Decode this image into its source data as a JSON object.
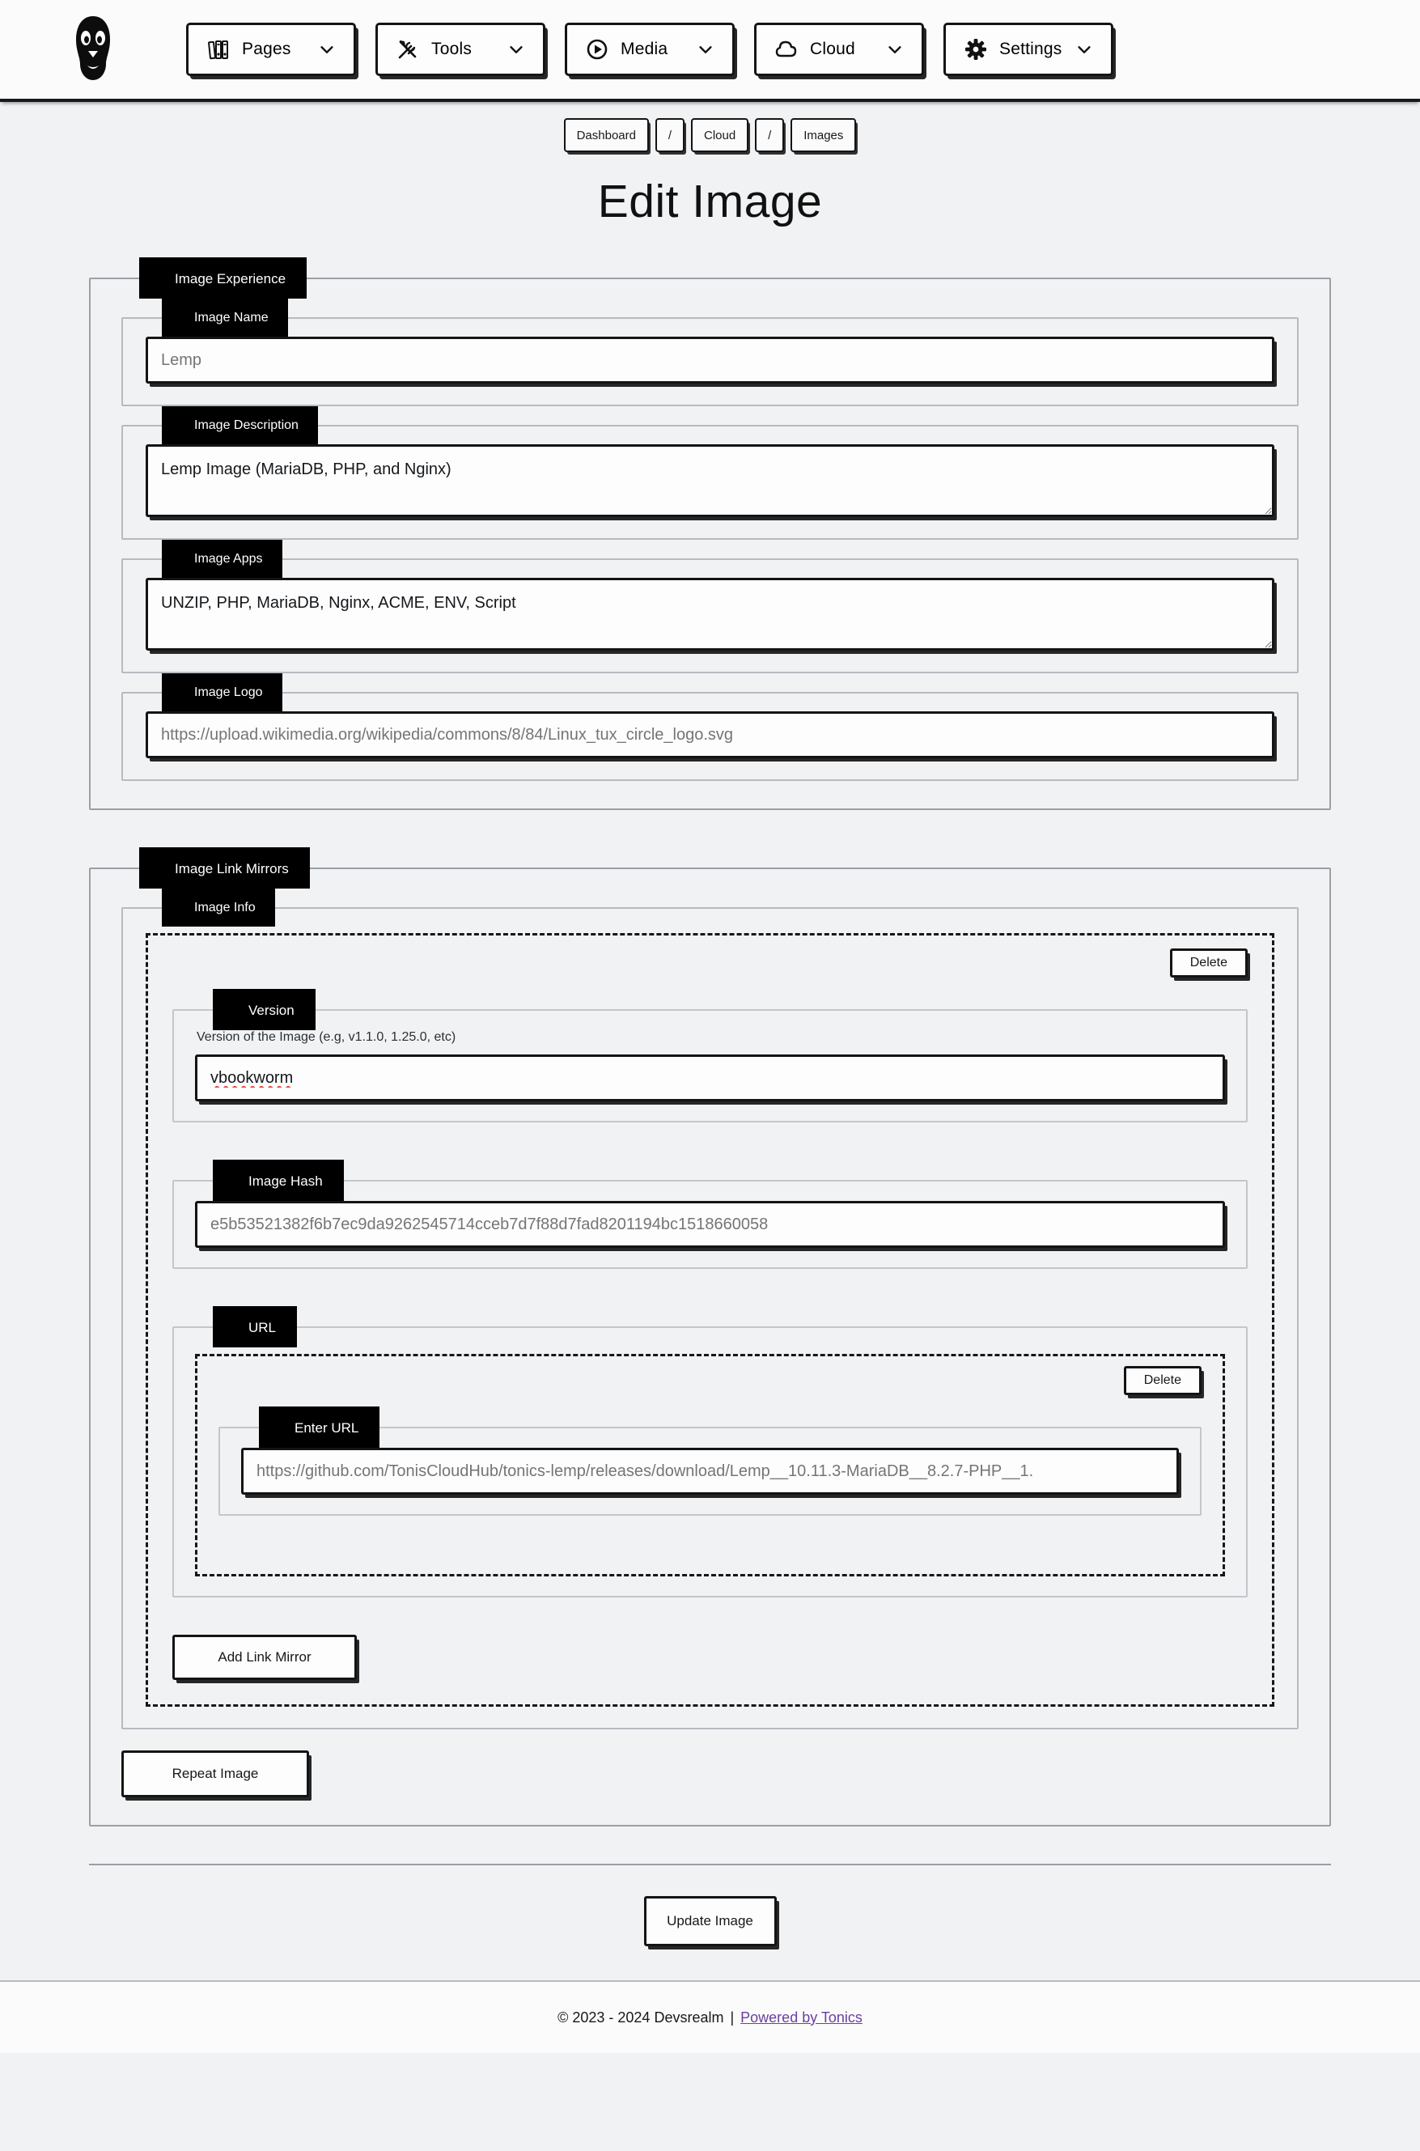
{
  "nav": {
    "logo_name": "devsrealm-tux-logo",
    "items": [
      {
        "label": "Pages",
        "icon": "books-icon"
      },
      {
        "label": "Tools",
        "icon": "tools-icon"
      },
      {
        "label": "Media",
        "icon": "play-circle-icon"
      },
      {
        "label": "Cloud",
        "icon": "cloud-icon"
      },
      {
        "label": "Settings",
        "icon": "gear-icon"
      }
    ]
  },
  "breadcrumb": {
    "items": [
      "Dashboard",
      "/",
      "Cloud",
      "/",
      "Images"
    ]
  },
  "page": {
    "title": "Edit Image"
  },
  "image_experience": {
    "legend": "Image Experience",
    "name": {
      "legend": "Image Name",
      "value": "Lemp",
      "placeholder": "Lemp"
    },
    "description": {
      "legend": "Image Description",
      "value": "Lemp Image (MariaDB, PHP, and Nginx)",
      "placeholder": "Image Description"
    },
    "apps": {
      "legend": "Image Apps",
      "value": "UNZIP, PHP, MariaDB, Nginx, ACME, ENV, Script",
      "placeholder": "Image Apps"
    },
    "logo": {
      "legend": "Image Logo",
      "value": "https://upload.wikimedia.org/wikipedia/commons/8/84/Linux_tux_circle_logo.svg",
      "placeholder": "https://upload.wikimedia.org/wikipedia/commons/8/84/Linux_tux_circle_logo.svg"
    }
  },
  "image_link_mirrors": {
    "legend": "Image Link Mirrors",
    "info": {
      "legend": "Image Info",
      "delete_label": "Delete",
      "version": {
        "legend": "Version",
        "helper": "Version of the Image (e.g, v1.1.0, 1.25.0, etc)",
        "value": "vbookworm",
        "placeholder": "Version"
      },
      "hash": {
        "legend": "Image Hash",
        "value": "e5b53521382f6b7ec9da9262545714cceb7d7f88d7fad8201194bc1518660058",
        "placeholder": "Image Hash"
      },
      "url": {
        "legend": "URL",
        "delete_label": "Delete",
        "enter_url": {
          "legend": "Enter URL",
          "value": "https://github.com/TonisCloudHub/tonics-lemp/releases/download/Lemp__10.11.3-MariaDB__8.2.7-PHP__1.",
          "placeholder": "Enter URL"
        }
      },
      "add_link_mirror_label": "Add Link Mirror"
    },
    "repeat_image_label": "Repeat Image"
  },
  "actions": {
    "update_label": "Update Image"
  },
  "footer": {
    "copyright": "© 2023 - 2024 Devsrealm",
    "separator": "|",
    "link_label": "Powered by Tonics",
    "link_color": "#6b3fa0"
  }
}
